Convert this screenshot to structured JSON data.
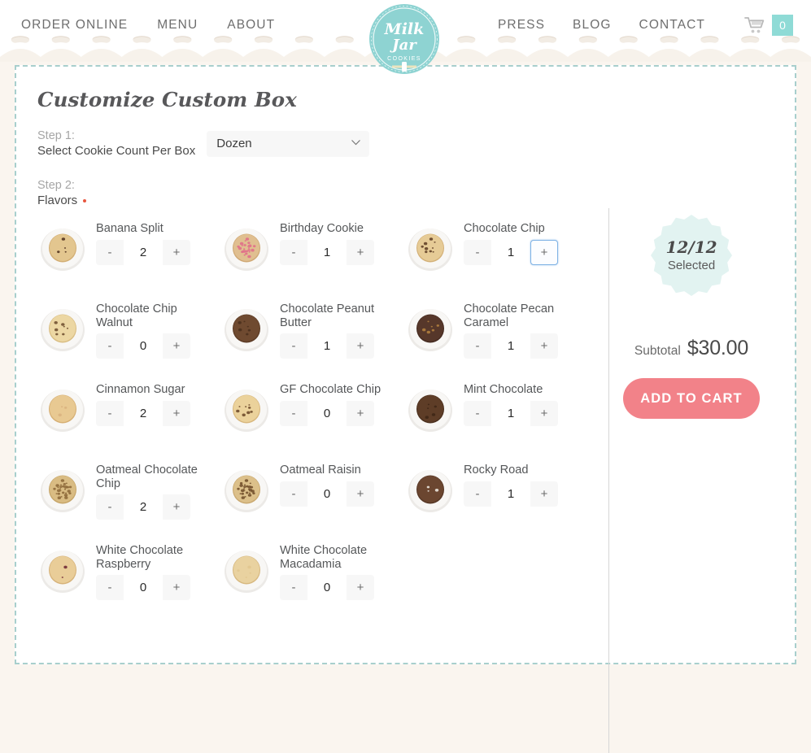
{
  "header": {
    "nav_left": [
      {
        "label": "ORDER ONLINE",
        "name": "nav-order-online"
      },
      {
        "label": "MENU",
        "name": "nav-menu"
      },
      {
        "label": "ABOUT",
        "name": "nav-about"
      }
    ],
    "nav_right": [
      {
        "label": "PRESS",
        "name": "nav-press"
      },
      {
        "label": "BLOG",
        "name": "nav-blog"
      },
      {
        "label": "CONTACT",
        "name": "nav-contact"
      }
    ],
    "cart_icon": "shopping-cart-icon",
    "cart_count": "0",
    "logo_alt": "Milk Jar Cookies",
    "logo_line1": "Milk",
    "logo_line2": "Jar",
    "logo_line3": "COOKIES"
  },
  "main": {
    "title": "Customize Custom Box",
    "step1_label": "Step 1:",
    "step1_sub": "Select Cookie Count Per Box",
    "step1_value": "Dozen",
    "step1_options": [
      "Dozen"
    ],
    "step2_label": "Step 2:",
    "step2_sub": "Flavors",
    "minus_label": "-",
    "plus_label": "+"
  },
  "flavors": [
    {
      "name": "Banana Split",
      "qty": "2",
      "focused": false
    },
    {
      "name": "Birthday Cookie",
      "qty": "1",
      "focused": false
    },
    {
      "name": "Chocolate Chip",
      "qty": "1",
      "focused": true
    },
    {
      "name": "Chocolate Chip Walnut",
      "qty": "0",
      "focused": false
    },
    {
      "name": "Chocolate Peanut Butter",
      "qty": "1",
      "focused": false
    },
    {
      "name": "Chocolate Pecan Caramel",
      "qty": "1",
      "focused": false
    },
    {
      "name": "Cinnamon Sugar",
      "qty": "2",
      "focused": false
    },
    {
      "name": "GF Chocolate Chip",
      "qty": "0",
      "focused": false
    },
    {
      "name": "Mint Chocolate",
      "qty": "1",
      "focused": false
    },
    {
      "name": "Oatmeal Chocolate Chip",
      "qty": "2",
      "focused": false
    },
    {
      "name": "Oatmeal Raisin",
      "qty": "0",
      "focused": false
    },
    {
      "name": "Rocky Road",
      "qty": "1",
      "focused": false
    },
    {
      "name": "White Chocolate Raspberry",
      "qty": "0",
      "focused": false
    },
    {
      "name": "White Chocolate Macadamia",
      "qty": "0",
      "focused": false
    }
  ],
  "sidebar": {
    "selected_count": "12/12",
    "selected_label": "Selected",
    "subtotal_label": "Subtotal",
    "subtotal_amount": "$30.00",
    "add_to_cart_label": "ADD TO CART"
  },
  "colors": {
    "accent_teal": "#8fdbd6",
    "badge_mint": "#e2f3f1",
    "cta_coral": "#f28289",
    "page_bg": "#faf5ef",
    "dashed_border": "#a8cfcd",
    "required_dot": "#e8563f",
    "focus_blue": "#7fb2e5"
  }
}
